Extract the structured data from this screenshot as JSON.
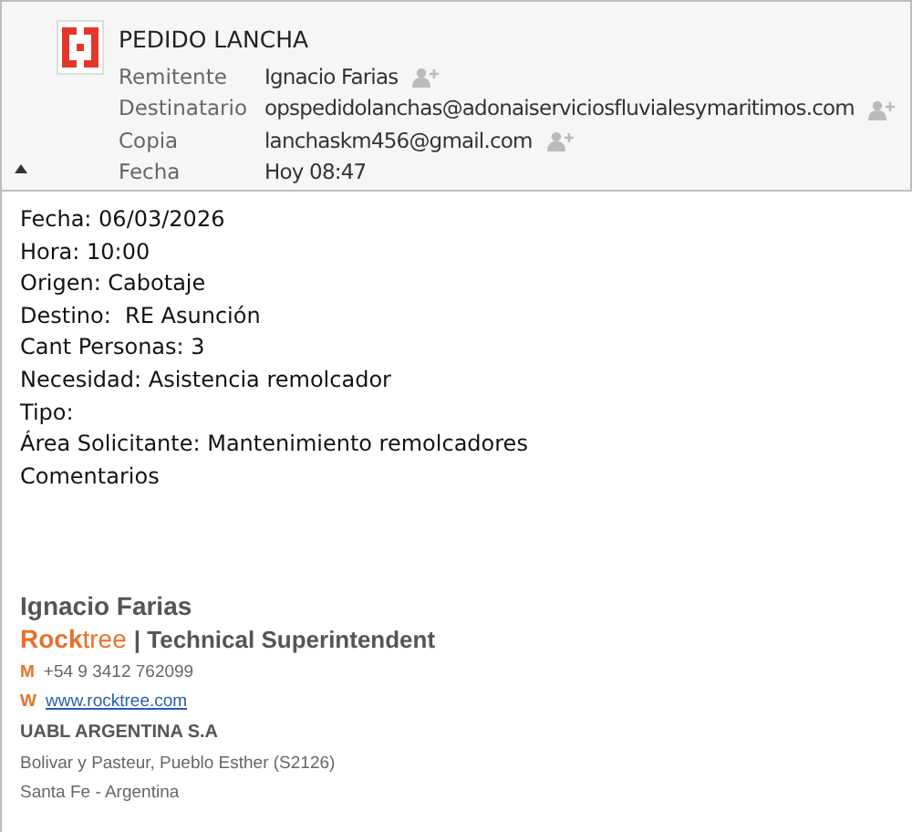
{
  "message": {
    "subject": "PEDIDO LANCHA",
    "fields": [
      {
        "label": "Remitente",
        "value": "Ignacio Farias",
        "kind": "contact"
      },
      {
        "label": "Destinatario",
        "value": "opspedidolanchas@adonaiserviciosfluvialesymaritimos.com",
        "kind": "contact"
      },
      {
        "label": "Copia",
        "value": "lanchaskm456@gmail.com",
        "kind": "contact"
      },
      {
        "label": "Fecha",
        "value": "Hoy 08:47",
        "kind": "date"
      }
    ],
    "expanded": true
  },
  "body": [
    "Fecha: 06/03/2026",
    "Hora: 10:00",
    "Origen: Cabotaje",
    "Destino:  RE Asunción",
    "Cant Personas: 3",
    "Necesidad: Asistencia remolcador",
    "Tipo:",
    "Área Solicitante: Mantenimiento remolcadores",
    "Comentarios"
  ],
  "signature": {
    "name": "Ignacio Farias",
    "brand": "**Rock**tree",
    "role": "| Technical Superintendent",
    "contacts": [
      {
        "label": "M",
        "value": "+54 9 3412 762099",
        "kind": "text"
      },
      {
        "label": "W",
        "value": "www.rocktree.com",
        "kind": "link"
      }
    ],
    "company": "UABL ARGENTINA S.A",
    "address": [
      "Bolivar y Pasteur, Pueblo Esther (S2126)",
      "Santa Fe - Argentina"
    ]
  }
}
